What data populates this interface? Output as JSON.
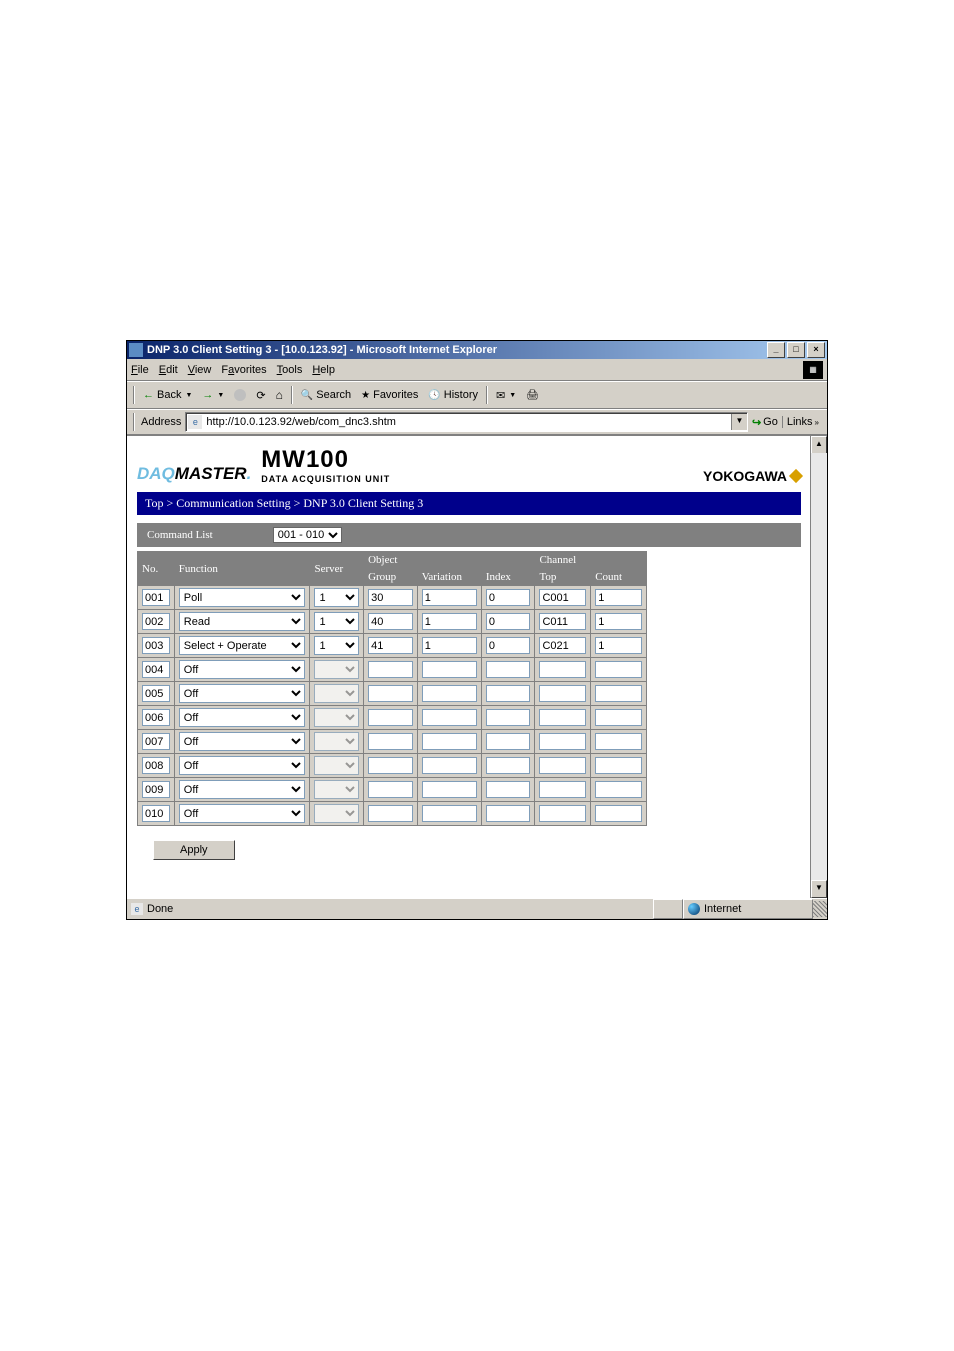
{
  "window": {
    "title": "DNP 3.0 Client Setting 3 - [10.0.123.92] - Microsoft Internet Explorer"
  },
  "menubar": [
    "File",
    "Edit",
    "View",
    "Favorites",
    "Tools",
    "Help"
  ],
  "toolbar": {
    "back": "Back",
    "search": "Search",
    "favorites": "Favorites",
    "history": "History"
  },
  "addressbar": {
    "label": "Address",
    "url": "http://10.0.123.92/web/com_dnc3.shtm",
    "go": "Go",
    "links": "Links"
  },
  "page": {
    "brand1_a": "DAQ",
    "brand1_b": "MASTER",
    "brand2_a": "MW100",
    "brand2_b": "DATA ACQUISITION UNIT",
    "brand3": "YOKOGAWA",
    "breadcrumb": "Top > Communication Setting > DNP 3.0 Client Setting 3",
    "cmdlist_label": "Command List",
    "range_selected": "001 - 010",
    "apply": "Apply"
  },
  "table": {
    "headers": {
      "no": "No.",
      "function": "Function",
      "server": "Server",
      "object": "Object",
      "group": "Group",
      "variation": "Variation",
      "index": "Index",
      "channel": "Channel",
      "top": "Top",
      "count": "Count"
    },
    "rows": [
      {
        "no": "001",
        "function": "Poll",
        "server": "1",
        "group": "30",
        "variation": "1",
        "index": "0",
        "top": "C001",
        "count": "1"
      },
      {
        "no": "002",
        "function": "Read",
        "server": "1",
        "group": "40",
        "variation": "1",
        "index": "0",
        "top": "C011",
        "count": "1"
      },
      {
        "no": "003",
        "function": "Select + Operate",
        "server": "1",
        "group": "41",
        "variation": "1",
        "index": "0",
        "top": "C021",
        "count": "1"
      },
      {
        "no": "004",
        "function": "Off",
        "server": "",
        "group": "",
        "variation": "",
        "index": "",
        "top": "",
        "count": ""
      },
      {
        "no": "005",
        "function": "Off",
        "server": "",
        "group": "",
        "variation": "",
        "index": "",
        "top": "",
        "count": ""
      },
      {
        "no": "006",
        "function": "Off",
        "server": "",
        "group": "",
        "variation": "",
        "index": "",
        "top": "",
        "count": ""
      },
      {
        "no": "007",
        "function": "Off",
        "server": "",
        "group": "",
        "variation": "",
        "index": "",
        "top": "",
        "count": ""
      },
      {
        "no": "008",
        "function": "Off",
        "server": "",
        "group": "",
        "variation": "",
        "index": "",
        "top": "",
        "count": ""
      },
      {
        "no": "009",
        "function": "Off",
        "server": "",
        "group": "",
        "variation": "",
        "index": "",
        "top": "",
        "count": ""
      },
      {
        "no": "010",
        "function": "Off",
        "server": "",
        "group": "",
        "variation": "",
        "index": "",
        "top": "",
        "count": ""
      }
    ]
  },
  "statusbar": {
    "done": "Done",
    "zone": "Internet"
  }
}
